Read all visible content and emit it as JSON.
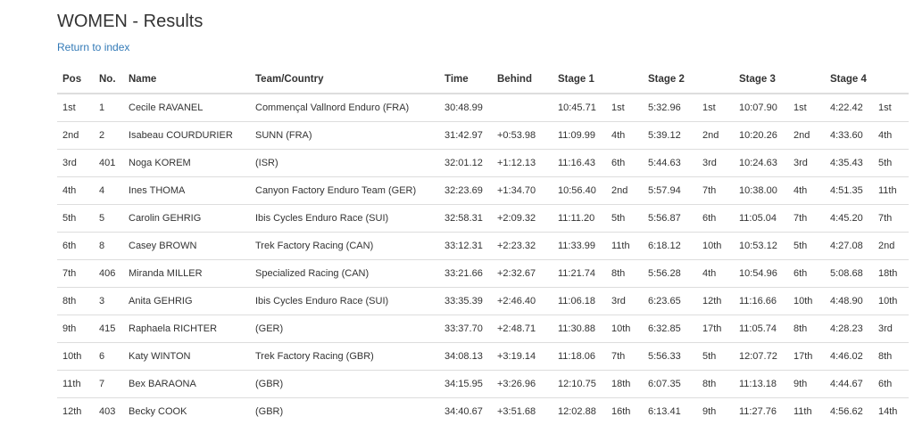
{
  "page": {
    "title": "WOMEN - Results",
    "back_link": "Return to index"
  },
  "table": {
    "headers": [
      "Pos",
      "No.",
      "Name",
      "Team/Country",
      "Time",
      "Behind",
      "Stage 1",
      "",
      "Stage 2",
      "",
      "Stage 3",
      "",
      "Stage 4",
      ""
    ],
    "rows": [
      [
        "1st",
        "1",
        "Cecile RAVANEL",
        "Commençal Vallnord Enduro (FRA)",
        "30:48.99",
        "",
        "10:45.71",
        "1st",
        "5:32.96",
        "1st",
        "10:07.90",
        "1st",
        "4:22.42",
        "1st"
      ],
      [
        "2nd",
        "2",
        "Isabeau COURDURIER",
        "SUNN (FRA)",
        "31:42.97",
        "+0:53.98",
        "11:09.99",
        "4th",
        "5:39.12",
        "2nd",
        "10:20.26",
        "2nd",
        "4:33.60",
        "4th"
      ],
      [
        "3rd",
        "401",
        "Noga KOREM",
        "(ISR)",
        "32:01.12",
        "+1:12.13",
        "11:16.43",
        "6th",
        "5:44.63",
        "3rd",
        "10:24.63",
        "3rd",
        "4:35.43",
        "5th"
      ],
      [
        "4th",
        "4",
        "Ines THOMA",
        "Canyon Factory Enduro Team (GER)",
        "32:23.69",
        "+1:34.70",
        "10:56.40",
        "2nd",
        "5:57.94",
        "7th",
        "10:38.00",
        "4th",
        "4:51.35",
        "11th"
      ],
      [
        "5th",
        "5",
        "Carolin GEHRIG",
        "Ibis Cycles Enduro Race (SUI)",
        "32:58.31",
        "+2:09.32",
        "11:11.20",
        "5th",
        "5:56.87",
        "6th",
        "11:05.04",
        "7th",
        "4:45.20",
        "7th"
      ],
      [
        "6th",
        "8",
        "Casey BROWN",
        "Trek Factory Racing (CAN)",
        "33:12.31",
        "+2:23.32",
        "11:33.99",
        "11th",
        "6:18.12",
        "10th",
        "10:53.12",
        "5th",
        "4:27.08",
        "2nd"
      ],
      [
        "7th",
        "406",
        "Miranda MILLER",
        "Specialized Racing (CAN)",
        "33:21.66",
        "+2:32.67",
        "11:21.74",
        "8th",
        "5:56.28",
        "4th",
        "10:54.96",
        "6th",
        "5:08.68",
        "18th"
      ],
      [
        "8th",
        "3",
        "Anita GEHRIG",
        "Ibis Cycles Enduro Race (SUI)",
        "33:35.39",
        "+2:46.40",
        "11:06.18",
        "3rd",
        "6:23.65",
        "12th",
        "11:16.66",
        "10th",
        "4:48.90",
        "10th"
      ],
      [
        "9th",
        "415",
        "Raphaela RICHTER",
        "(GER)",
        "33:37.70",
        "+2:48.71",
        "11:30.88",
        "10th",
        "6:32.85",
        "17th",
        "11:05.74",
        "8th",
        "4:28.23",
        "3rd"
      ],
      [
        "10th",
        "6",
        "Katy WINTON",
        "Trek Factory Racing (GBR)",
        "34:08.13",
        "+3:19.14",
        "11:18.06",
        "7th",
        "5:56.33",
        "5th",
        "12:07.72",
        "17th",
        "4:46.02",
        "8th"
      ],
      [
        "11th",
        "7",
        "Bex BARAONA",
        "(GBR)",
        "34:15.95",
        "+3:26.96",
        "12:10.75",
        "18th",
        "6:07.35",
        "8th",
        "11:13.18",
        "9th",
        "4:44.67",
        "6th"
      ],
      [
        "12th",
        "403",
        "Becky COOK",
        "(GBR)",
        "34:40.67",
        "+3:51.68",
        "12:02.88",
        "16th",
        "6:13.41",
        "9th",
        "11:27.76",
        "11th",
        "4:56.62",
        "14th"
      ]
    ]
  }
}
